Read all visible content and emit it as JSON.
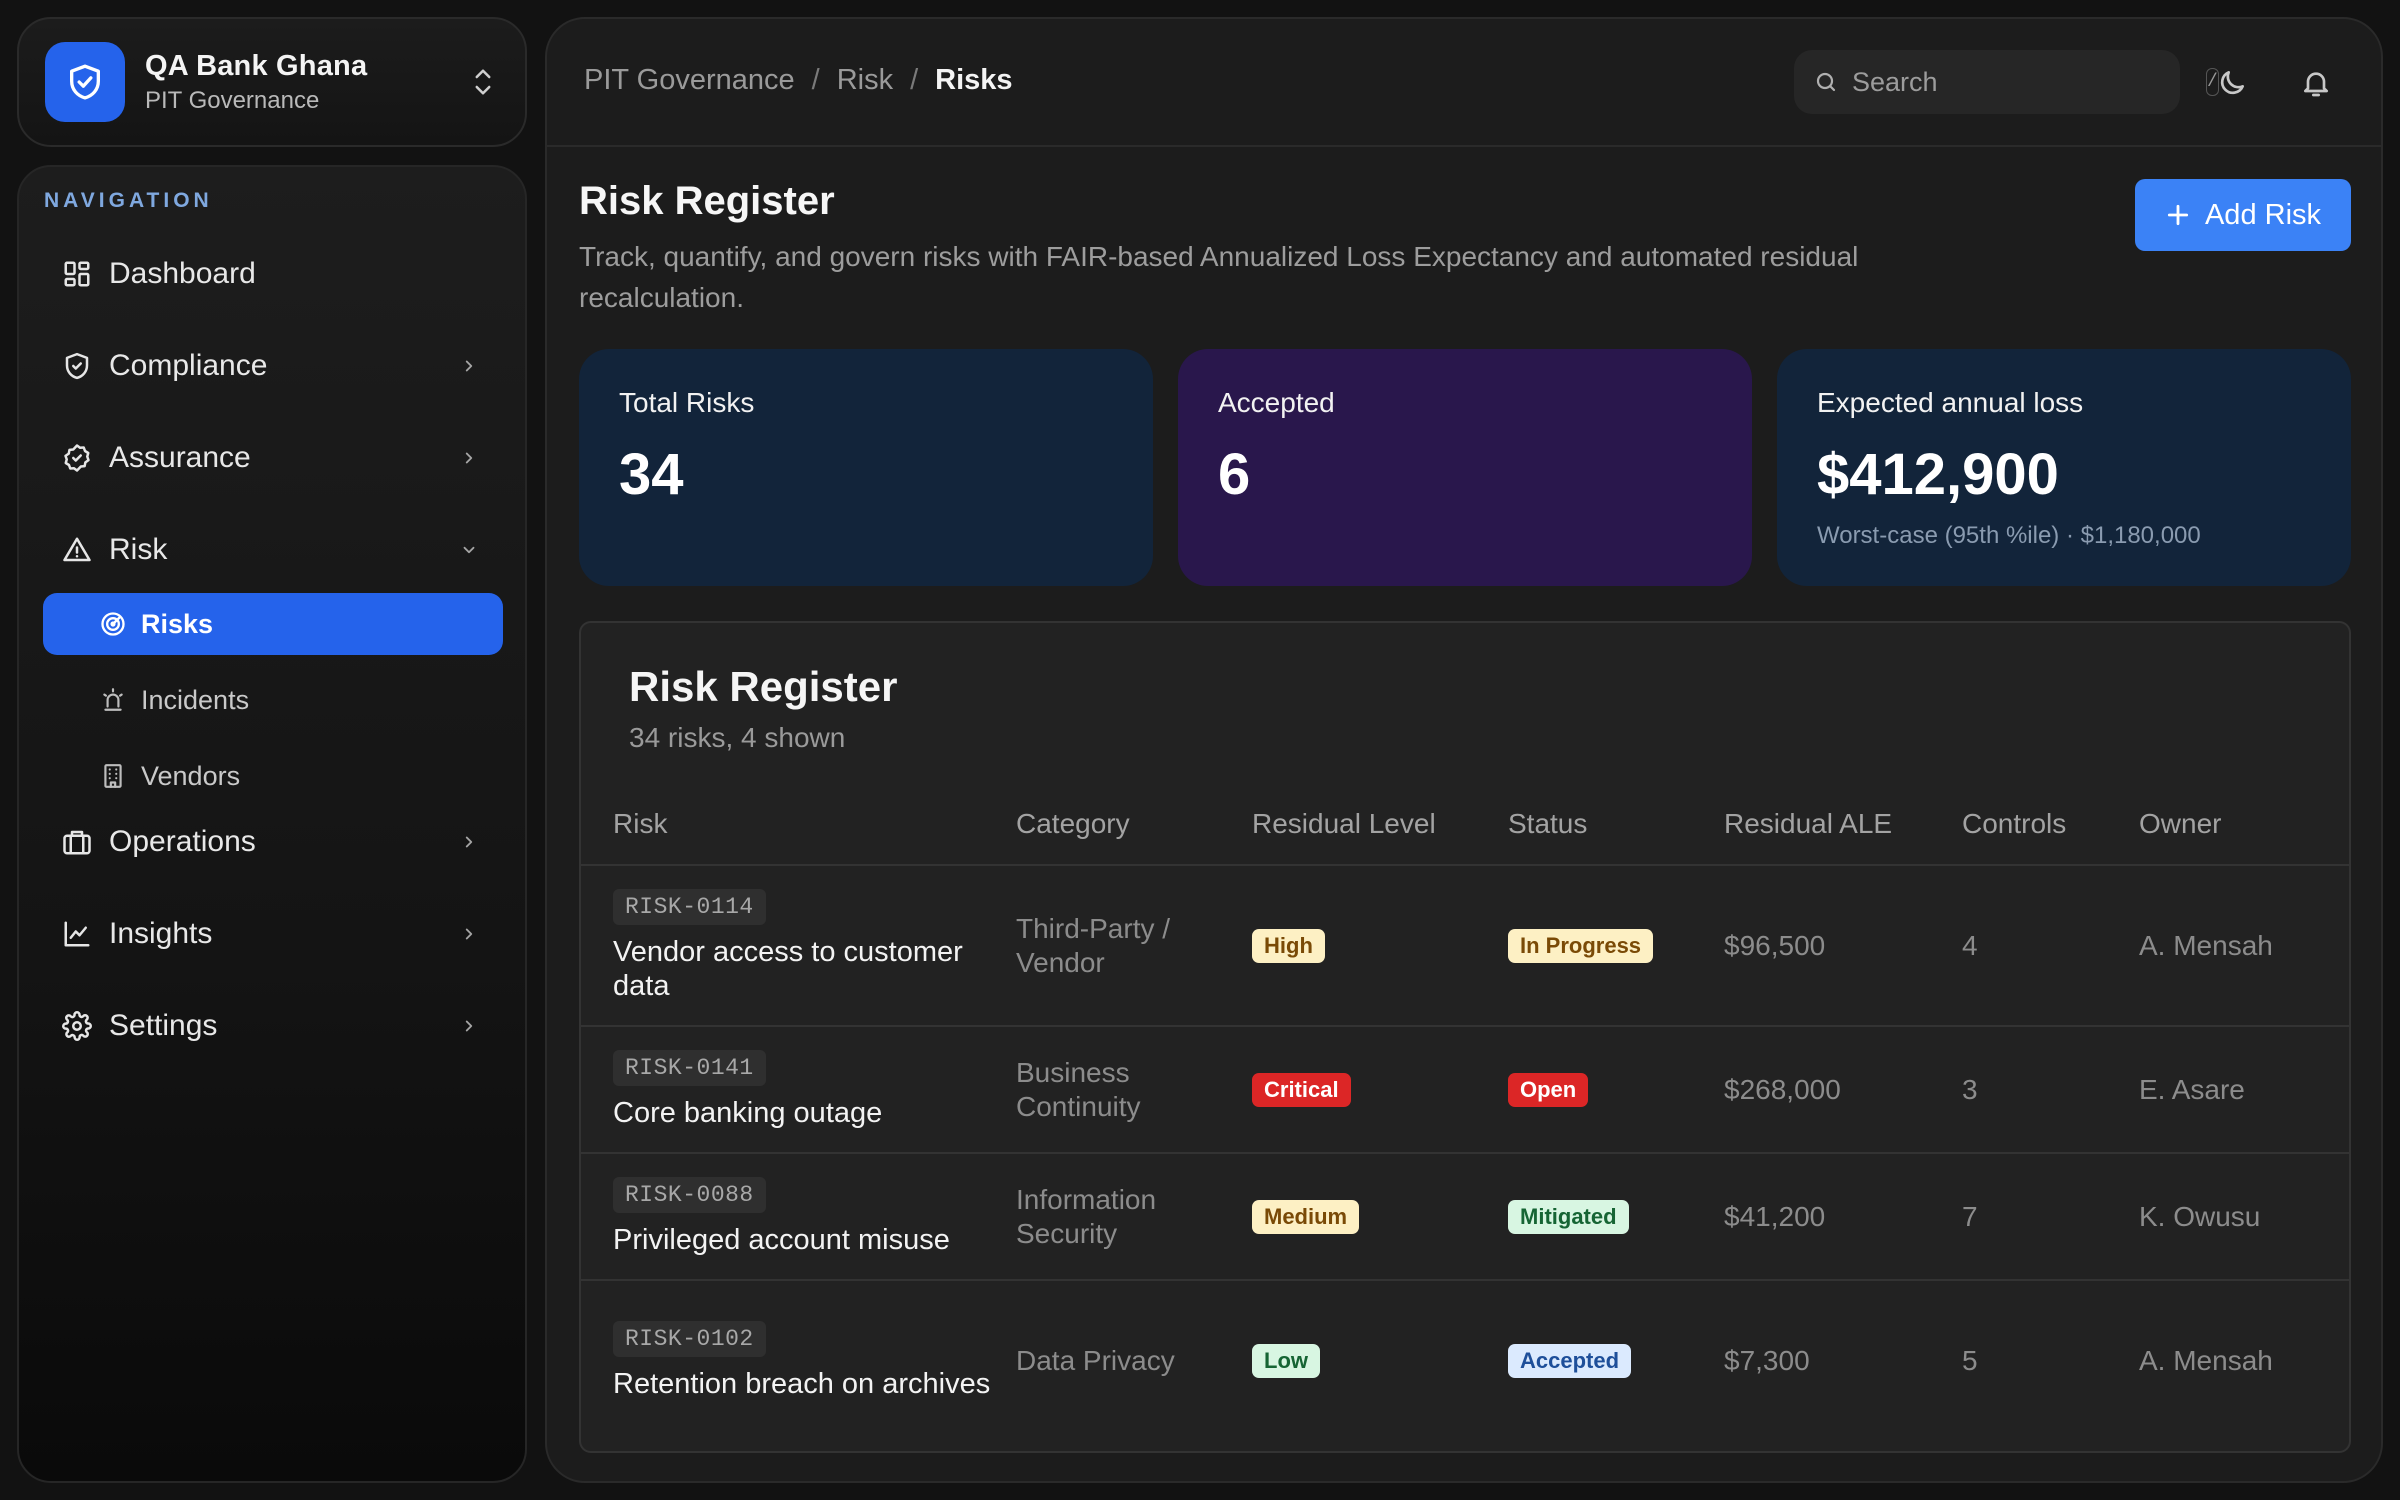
{
  "org": {
    "name": "QA Bank Ghana",
    "subtitle": "PIT Governance"
  },
  "nav": {
    "heading": "NAVIGATION",
    "items": [
      {
        "label": "Dashboard",
        "icon": "dashboard-icon",
        "has_chevron": false
      },
      {
        "label": "Compliance",
        "icon": "shield-check-icon",
        "has_chevron": true
      },
      {
        "label": "Assurance",
        "icon": "badge-check-icon",
        "has_chevron": true
      },
      {
        "label": "Risk",
        "icon": "warning-triangle-icon",
        "has_chevron": true,
        "expanded": true
      },
      {
        "label": "Operations",
        "icon": "briefcase-icon",
        "has_chevron": true
      },
      {
        "label": "Insights",
        "icon": "line-chart-icon",
        "has_chevron": true
      },
      {
        "label": "Settings",
        "icon": "gear-icon",
        "has_chevron": true
      }
    ],
    "risk_children": [
      {
        "label": "Risks",
        "icon": "radar-icon",
        "active": true
      },
      {
        "label": "Incidents",
        "icon": "siren-icon",
        "active": false
      },
      {
        "label": "Vendors",
        "icon": "building-icon",
        "active": false
      }
    ]
  },
  "breadcrumb": [
    "PIT Governance",
    "Risk",
    "Risks"
  ],
  "search": {
    "placeholder": "Search",
    "shortcut": "/"
  },
  "page": {
    "title": "Risk Register",
    "description": "Track, quantify, and govern risks with FAIR-based Annualized Loss Expectancy and automated residual recalculation.",
    "add_button": "Add Risk"
  },
  "stats": [
    {
      "label": "Total Risks",
      "value": "34",
      "note": "",
      "bg": "#12243a"
    },
    {
      "label": "Accepted",
      "value": "6",
      "note": "",
      "bg": "#29174c"
    },
    {
      "label": "Expected annual loss",
      "value": "$412,900",
      "note": "Worst-case (95th %ile) · $1,180,000",
      "bg": "#12243a"
    }
  ],
  "register": {
    "title": "Risk Register",
    "subtitle": "34 risks, 4 shown",
    "columns": [
      "Risk",
      "Category",
      "Residual Level",
      "Status",
      "Residual ALE",
      "Controls",
      "Owner"
    ],
    "rows": [
      {
        "id": "RISK-0114",
        "name": "Vendor access to customer data",
        "category": "Third-Party / Vendor",
        "level": "High",
        "status": "In Progress",
        "ale": "$96,500",
        "controls": "4",
        "owner": "A. Mensah"
      },
      {
        "id": "RISK-0141",
        "name": "Core banking outage",
        "category": "Business Continuity",
        "level": "Critical",
        "status": "Open",
        "ale": "$268,000",
        "controls": "3",
        "owner": "E. Asare"
      },
      {
        "id": "RISK-0088",
        "name": "Privileged account misuse",
        "category": "Information Security",
        "level": "Medium",
        "status": "Mitigated",
        "ale": "$41,200",
        "controls": "7",
        "owner": "K. Owusu"
      },
      {
        "id": "RISK-0102",
        "name": "Retention breach on archives",
        "category": "Data Privacy",
        "level": "Low",
        "status": "Accepted",
        "ale": "$7,300",
        "controls": "5",
        "owner": "A. Mensah"
      }
    ]
  },
  "badge_colors": {
    "High": {
      "bg": "#fdf0c4",
      "fg": "#7a4a06"
    },
    "Critical": {
      "bg": "#dc2626",
      "fg": "#ffffff"
    },
    "Medium": {
      "bg": "#fdf0c4",
      "fg": "#7a4a06"
    },
    "Low": {
      "bg": "#d8f6e2",
      "fg": "#166534"
    },
    "In Progress": {
      "bg": "#fdf0c4",
      "fg": "#7a4a06"
    },
    "Open": {
      "bg": "#dc2626",
      "fg": "#ffffff"
    },
    "Mitigated": {
      "bg": "#d8f6e2",
      "fg": "#166534"
    },
    "Accepted": {
      "bg": "#dbeafe",
      "fg": "#1e4f9a"
    }
  },
  "colors": {
    "accent": "#2563eb",
    "button": "#3b82f6"
  }
}
